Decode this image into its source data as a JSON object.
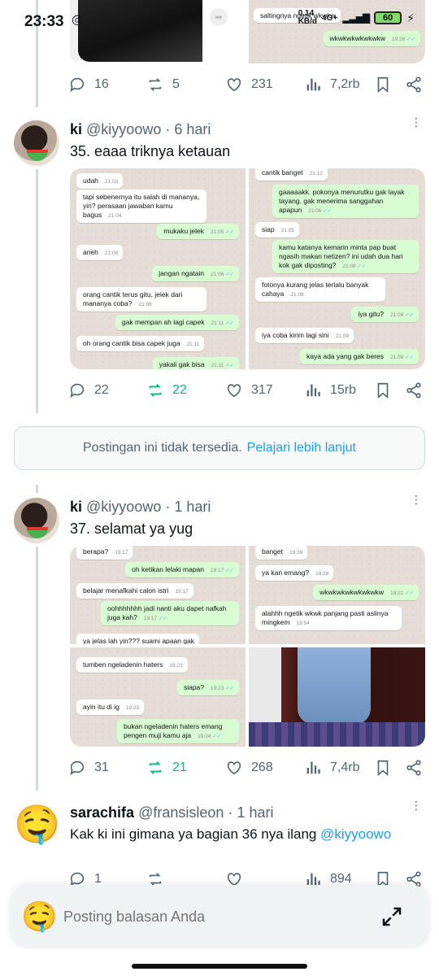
{
  "status_bar": {
    "time": "23:33",
    "net_speed": "0,14\nKB/d",
    "network": "4G+",
    "battery": "60"
  },
  "tweet_top": {
    "chat_text_1": "saltingnya ngetik wkwkw",
    "chat_text_2": "wkwkwkwkwkwkw",
    "chat_time_2": "19:28",
    "replies": "16",
    "reposts": "5",
    "likes": "231",
    "views": "7,2rb"
  },
  "tweet_35": {
    "name": "ki",
    "handle": "@kiyyoowo",
    "age": "6 hari",
    "text": "35. eaaa triknya ketauan",
    "left_chat": [
      {
        "dir": "in",
        "text": "udah",
        "time": "21:03"
      },
      {
        "dir": "in",
        "text": "tapi sebenernya itu salah di mananya, yin? perasaan jawaban kamu bagus",
        "time": "21:04"
      },
      {
        "dir": "out",
        "text": "mukaku jelek",
        "time": "21:05"
      },
      {
        "dir": "in",
        "text": "aneh",
        "time": "21:06"
      },
      {
        "dir": "out",
        "text": "jangan ngatain",
        "time": "21:06"
      },
      {
        "dir": "in",
        "text": "orang cantik terus gitu, jelek dari mananya coba?",
        "time": "21:06"
      },
      {
        "dir": "out",
        "text": "gak mempan ah lagi capek",
        "time": "21:11"
      },
      {
        "dir": "in",
        "text": "oh orang cantik bisa capek juga",
        "time": "21:11"
      },
      {
        "dir": "out",
        "text": "yakali gak bisa",
        "time": "21:11"
      }
    ],
    "right_chat": [
      {
        "dir": "in",
        "text": "cantik banget",
        "time": "21:12"
      },
      {
        "dir": "out",
        "text": "gaaaaakk. pokonya menurutku gak layak tayang. gak menerima sanggahan apapun",
        "time": "21:06"
      },
      {
        "dir": "in",
        "text": "siap",
        "time": "21:05"
      },
      {
        "dir": "out",
        "text": "kamu katanya kemarin minta pap buat ngasih makan netizen? ini udah dua hari kok gak diposting?",
        "time": "21:08"
      },
      {
        "dir": "in",
        "text": "fotonya kurang jelas terlalu banyak cahaya",
        "time": "21:08"
      },
      {
        "dir": "out",
        "text": "iya gitu?",
        "time": "21:09"
      },
      {
        "dir": "in",
        "text": "iya coba kirim lagi sini",
        "time": "21:09"
      },
      {
        "dir": "out",
        "text": "kaya ada yang gak beres",
        "time": "21:09"
      }
    ],
    "replies": "22",
    "reposts": "22",
    "likes": "317",
    "views": "15rb"
  },
  "notice": {
    "text": "Postingan ini tidak tersedia.",
    "link": "Pelajari lebih lanjut"
  },
  "tweet_37": {
    "name": "ki",
    "handle": "@kiyyoowo",
    "age": "1 hari",
    "text": "37. selamat ya yug",
    "tl_chat": [
      {
        "dir": "in",
        "text": "berapa?",
        "time": "19:17"
      },
      {
        "dir": "out",
        "text": "oh ketikan lelaki mapan",
        "time": "19:17"
      },
      {
        "dir": "in",
        "text": "belajar menafkahi calon istri",
        "time": "19:17"
      },
      {
        "dir": "out",
        "text": "oohhhhhhh jadi nanti aku dapet nafkah juga kah?",
        "time": "19:17"
      },
      {
        "dir": "in",
        "text": "ya jelas lah yin??? suami apaan gak",
        "time": ""
      }
    ],
    "tr_chat": [
      {
        "dir": "in",
        "text": "banget",
        "time": "19:38"
      },
      {
        "dir": "in",
        "text": "ya kan emang?",
        "time": "19:28"
      },
      {
        "dir": "out",
        "text": "wkwkwkwkwkwkwkw",
        "time": "19:22"
      },
      {
        "dir": "in",
        "text": "alahhh ngetik wkwk panjang pasti aslinya mingkem",
        "time": "19:54"
      }
    ],
    "bl_chat": [
      {
        "dir": "in",
        "text": "tumben ngeladenin haters",
        "time": "19:23"
      },
      {
        "dir": "out",
        "text": "siapa?",
        "time": "19:23"
      },
      {
        "dir": "in",
        "text": "ayin itu di ig",
        "time": "19:23"
      },
      {
        "dir": "out",
        "text": "bukan ngeladenin haters emang pengen muji kamu aja",
        "time": "19:24"
      }
    ],
    "replies": "31",
    "reposts": "21",
    "likes": "268",
    "views": "7,4rb"
  },
  "tweet_reply": {
    "name": "sarachifa",
    "handle": "@fransisleon",
    "age": "1 hari",
    "text": "Kak ki ini gimana ya bagian 36 nya ilang",
    "mention": "@kiyyoowo",
    "replies": "1",
    "views": "894"
  },
  "reply_bar": {
    "placeholder": "Posting balasan Anda"
  },
  "colors": {
    "accent": "#1d9bf0",
    "repost_active": "#00ba7c",
    "muted": "#536471"
  }
}
